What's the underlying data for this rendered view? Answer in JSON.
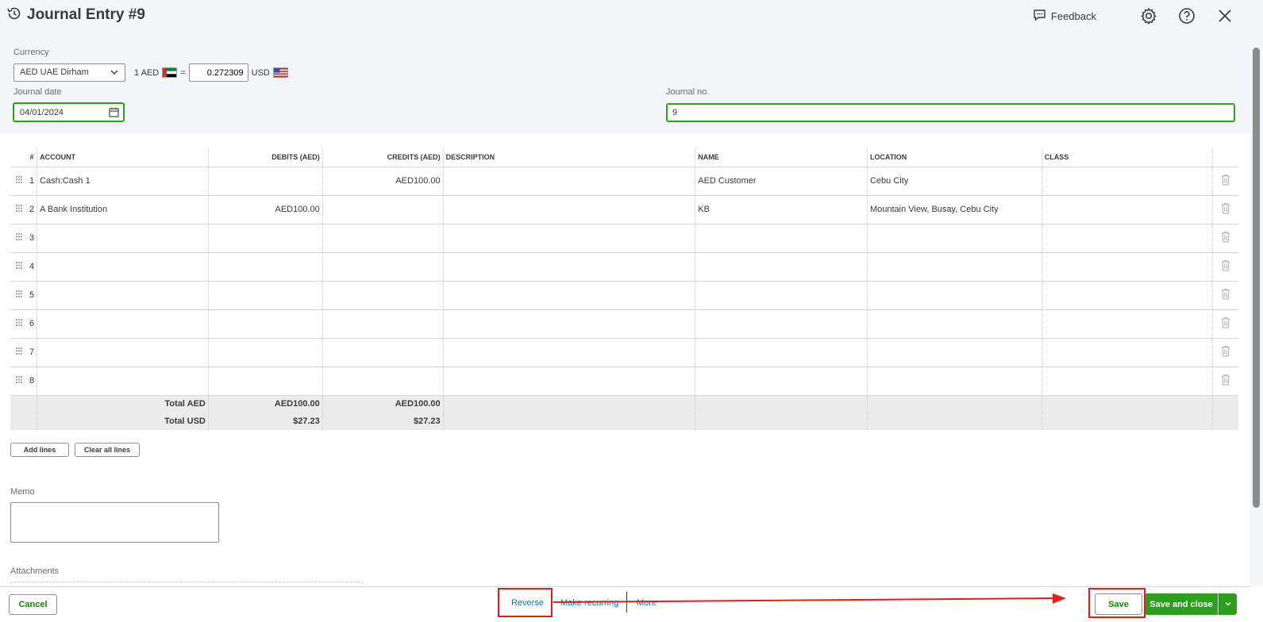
{
  "header": {
    "title": "Journal Entry #9",
    "feedback_label": "Feedback"
  },
  "form": {
    "currency_label": "Currency",
    "currency_value": "AED UAE Dirham",
    "rate_prefix": "1 AED",
    "rate_equals": "=",
    "rate_value": "0.272309",
    "rate_suffix": "USD",
    "journal_date_label": "Journal date",
    "journal_date_value": "04/01/2024",
    "journal_no_label": "Journal no.",
    "journal_no_value": "9"
  },
  "table": {
    "columns": [
      "#",
      "ACCOUNT",
      "DEBITS (AED)",
      "CREDITS (AED)",
      "DESCRIPTION",
      "NAME",
      "LOCATION",
      "CLASS"
    ],
    "rows": [
      {
        "num": "1",
        "account": "Cash:Cash 1",
        "debit": "",
        "credit": "AED100.00",
        "description": "",
        "name": "AED Customer",
        "location": "Cebu City",
        "class": ""
      },
      {
        "num": "2",
        "account": "A Bank Institution",
        "debit": "AED100.00",
        "credit": "",
        "description": "",
        "name": "KB",
        "location": "Mountain View, Busay, Cebu City",
        "class": ""
      },
      {
        "num": "3",
        "account": "",
        "debit": "",
        "credit": "",
        "description": "",
        "name": "",
        "location": "",
        "class": ""
      },
      {
        "num": "4",
        "account": "",
        "debit": "",
        "credit": "",
        "description": "",
        "name": "",
        "location": "",
        "class": ""
      },
      {
        "num": "5",
        "account": "",
        "debit": "",
        "credit": "",
        "description": "",
        "name": "",
        "location": "",
        "class": ""
      },
      {
        "num": "6",
        "account": "",
        "debit": "",
        "credit": "",
        "description": "",
        "name": "",
        "location": "",
        "class": ""
      },
      {
        "num": "7",
        "account": "",
        "debit": "",
        "credit": "",
        "description": "",
        "name": "",
        "location": "",
        "class": ""
      },
      {
        "num": "8",
        "account": "",
        "debit": "",
        "credit": "",
        "description": "",
        "name": "",
        "location": "",
        "class": ""
      }
    ],
    "totals": [
      {
        "label": "Total AED",
        "debit": "AED100.00",
        "credit": "AED100.00"
      },
      {
        "label": "Total USD",
        "debit": "$27.23",
        "credit": "$27.23"
      }
    ]
  },
  "actions": {
    "add_lines": "Add lines",
    "clear_all_lines": "Clear all lines"
  },
  "memo_label": "Memo",
  "attachments_label": "Attachments",
  "footer": {
    "cancel": "Cancel",
    "reverse": "Reverse",
    "make_recurring": "Make recurring",
    "more": "More",
    "save": "Save",
    "save_and_close": "Save and close"
  },
  "colors": {
    "accent_green": "#2ca01c",
    "link_blue": "#0077c5",
    "highlight_red": "#e0201b"
  }
}
